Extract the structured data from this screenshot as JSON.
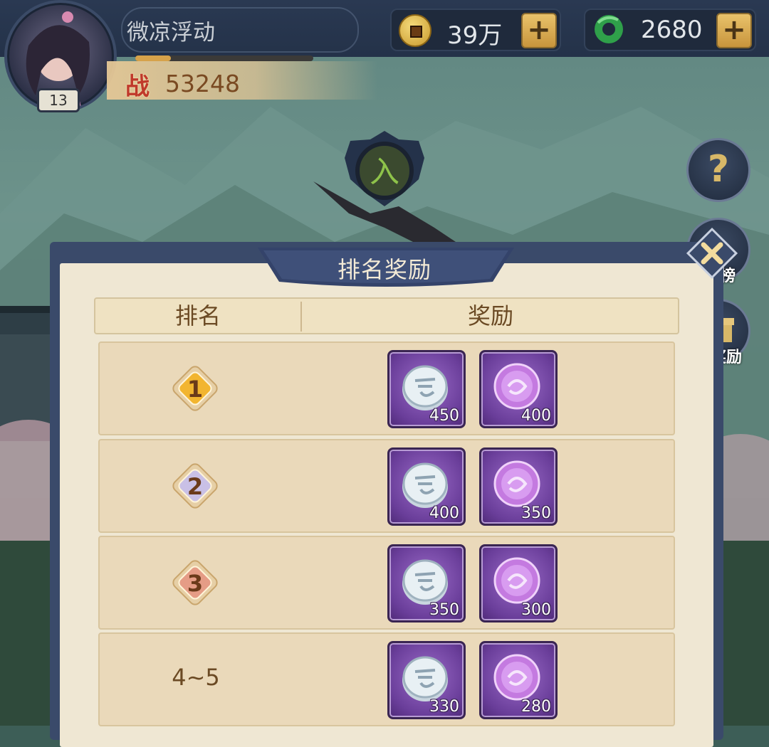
{
  "player": {
    "name": "微凉浮动",
    "level": "13",
    "xp_fraction": 0.2,
    "power_icon": "战",
    "power": "53248"
  },
  "currencies": [
    {
      "icon": "copper-coin-icon",
      "value": "39万",
      "plus": "+"
    },
    {
      "icon": "jade-icon",
      "value": "2680",
      "plus": "+"
    }
  ],
  "side_buttons": {
    "help": "?",
    "rank_label_partial": "行榜",
    "reward_label_partial": "名奖励"
  },
  "modal": {
    "title": "排名奖励",
    "header": {
      "rank": "排名",
      "reward": "奖励"
    },
    "rows": [
      {
        "rank": "1",
        "badge_color": "#f2b530",
        "rewards": [
          {
            "icon": "silver-spirit-coin-icon",
            "count": "450"
          },
          {
            "icon": "purple-spirit-coin-icon",
            "count": "400"
          }
        ]
      },
      {
        "rank": "2",
        "badge_color": "#c9c0e6",
        "rewards": [
          {
            "icon": "silver-spirit-coin-icon",
            "count": "400"
          },
          {
            "icon": "purple-spirit-coin-icon",
            "count": "350"
          }
        ]
      },
      {
        "rank": "3",
        "badge_color": "#e59c86",
        "rewards": [
          {
            "icon": "silver-spirit-coin-icon",
            "count": "350"
          },
          {
            "icon": "purple-spirit-coin-icon",
            "count": "300"
          }
        ]
      },
      {
        "rank": "4~5",
        "badge_color": "",
        "rewards": [
          {
            "icon": "silver-spirit-coin-icon",
            "count": "330"
          },
          {
            "icon": "purple-spirit-coin-icon",
            "count": "280"
          }
        ]
      }
    ]
  },
  "emblem_glyph": "入",
  "colors": {
    "hud": "#243249",
    "panel": "#efe7d3",
    "accent_gold": "#d6a24a"
  }
}
